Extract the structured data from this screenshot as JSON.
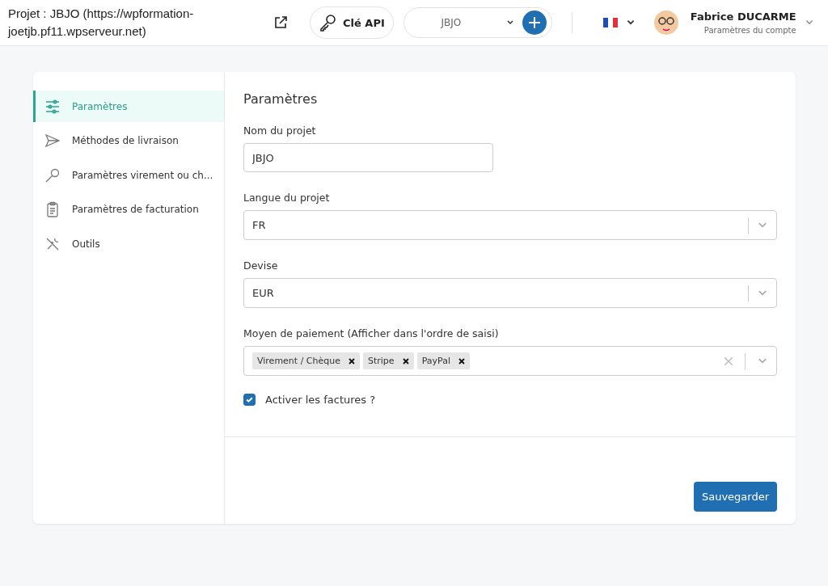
{
  "header": {
    "project_title": "Projet : JBJO (https://wpformation-joetjb.pf11.wpserveur.net)",
    "api_key_button": "Clé API",
    "project_select": {
      "value": "JBJO"
    },
    "user": {
      "name": "Fabrice DUCARME",
      "subtitle": "Paramètres du compte"
    }
  },
  "sidebar": {
    "items": [
      {
        "label": "Paramètres",
        "selected": true
      },
      {
        "label": "Méthodes de livraison",
        "selected": false
      },
      {
        "label": "Paramètres virement ou ch...",
        "selected": false
      },
      {
        "label": "Paramètres de facturation",
        "selected": false
      },
      {
        "label": "Outils",
        "selected": false
      }
    ]
  },
  "form": {
    "title": "Paramètres",
    "project_name": {
      "label": "Nom du projet",
      "value": "JBJO"
    },
    "language": {
      "label": "Langue du projet",
      "value": "FR"
    },
    "currency": {
      "label": "Devise",
      "value": "EUR"
    },
    "payment": {
      "label": "Moyen de paiement (Afficher dans l'ordre de saisi)",
      "tags": [
        "Virement / Chèque",
        "Stripe",
        "PayPal"
      ]
    },
    "invoices": {
      "label": "Activer les factures ?",
      "checked": true
    },
    "save_button": "Sauvegarder"
  }
}
